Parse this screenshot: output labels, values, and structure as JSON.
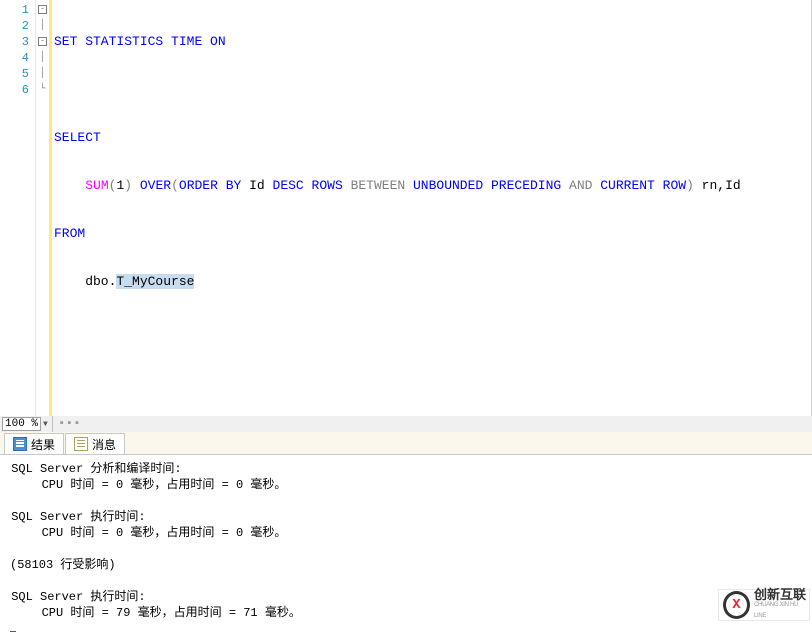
{
  "editor": {
    "lines": {
      "l1": "1",
      "l2": "2",
      "l3": "3",
      "l4": "4",
      "l5": "5",
      "l6": "6"
    },
    "code": {
      "set": "SET",
      "statistics": " STATISTICS",
      "time": " TIME",
      "on": " ON",
      "select": "SELECT",
      "sum": "SUM",
      "open_p": "(",
      "one": "1",
      "close_p": ") ",
      "over": "OVER",
      "open_p2": "(",
      "order_by": "ORDER BY",
      "id": " Id ",
      "desc": "DESC",
      "rows": " ROWS",
      "between": " BETWEEN ",
      "unbounded": "UNBOUNDED",
      "preceding": " PRECEDING",
      "and": " AND ",
      "current": "CURRENT",
      "row": " ROW",
      "close_p2": ")",
      "alias": " rn,Id",
      "from": "FROM",
      "dbo": "    dbo.",
      "table": "T_MyCourse"
    }
  },
  "zoom": {
    "value": "100 %"
  },
  "tabs": {
    "results": "结果",
    "messages": "消息"
  },
  "messages": {
    "parse_header": " SQL Server 分析和编译时间:",
    "parse_detail": "   CPU 时间 = 0 毫秒，占用时间 = 0 毫秒。",
    "exec1_header": " SQL Server 执行时间:",
    "exec1_detail": "   CPU 时间 = 0 毫秒，占用时间 = 0 毫秒。",
    "rows": "(58103 行受影响)",
    "exec2_header": " SQL Server 执行时间:",
    "exec2_detail": "   CPU 时间 = 79 毫秒，占用时间 = 71 毫秒。"
  },
  "watermark": {
    "big": "创新互联",
    "sub": "CHUANG XIN HU LINE"
  }
}
